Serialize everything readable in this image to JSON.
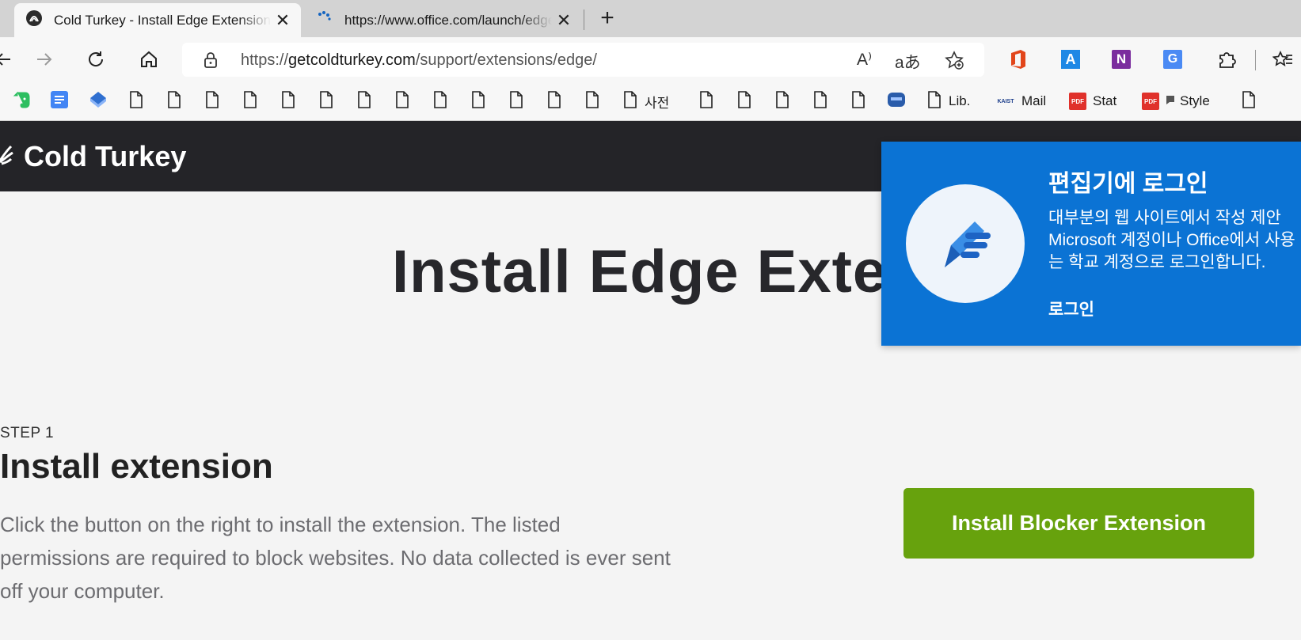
{
  "tabs": [
    {
      "title": "Cold Turkey - Install Edge Extension",
      "close": "✕",
      "icon": "cold-turkey-favicon"
    },
    {
      "title": "https://www.office.com/launch/edge",
      "close": "✕",
      "icon": "loading-spinner-icon"
    }
  ],
  "newtab_label": "+",
  "address_bar": {
    "scheme": "https://",
    "host": "getcoldturkey.com",
    "path": "/support/extensions/edge/",
    "read_aloud_label": "A⁾",
    "translate_label": "aあ"
  },
  "bookmarks": [
    {
      "label": "사전"
    },
    {
      "label": "Lib."
    },
    {
      "label": "Mail",
      "badge": "KAIST"
    },
    {
      "label": "Stat",
      "badge": "PDF"
    },
    {
      "label": "Style",
      "badge": "PDF"
    }
  ],
  "extension_letters": {
    "translator": "A",
    "onenote": "N",
    "google_translate": "G"
  },
  "site": {
    "brand": "Cold Turkey",
    "page_title": "Install Edge Extension",
    "step_label": "STEP 1",
    "step_title": "Install extension",
    "description": "Click the button on the right to install the extension. The listed permissions are required to block websites. No data collected is ever sent off your computer.",
    "install_button": "Install Blocker Extension"
  },
  "popup": {
    "title": "편집기에 로그인",
    "body": "대부분의 웹 사이트에서 작성 제안\nMicrosoft 계정이나 Office에서 사용\n는 학교 계정으로 로그인합니다.",
    "link": "로그인"
  },
  "colors": {
    "header_bg": "#242428",
    "install_green": "#67a20d",
    "popup_blue": "#0b73d4"
  }
}
